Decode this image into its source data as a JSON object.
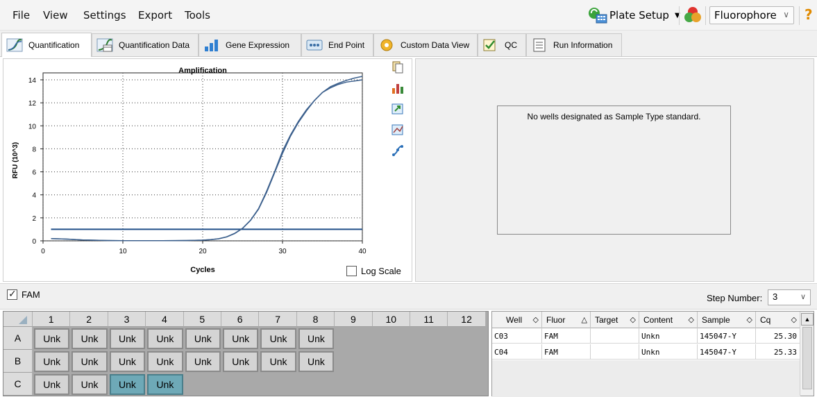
{
  "menu": {
    "items": [
      "File",
      "View",
      "Settings",
      "Export",
      "Tools"
    ]
  },
  "toolbar": {
    "plate_setup_label": "Plate Setup",
    "fluorophore_select": "Fluorophore",
    "help_symbol": "?"
  },
  "tabs": [
    {
      "label": "Quantification",
      "icon": "amplification-icon",
      "active": true
    },
    {
      "label": "Quantification Data",
      "icon": "quant-data-icon"
    },
    {
      "label": "Gene Expression",
      "icon": "bar-chart-icon"
    },
    {
      "label": "End Point",
      "icon": "end-point-icon"
    },
    {
      "label": "Custom Data View",
      "icon": "puzzle-icon"
    },
    {
      "label": "QC",
      "icon": "qc-check-icon"
    },
    {
      "label": "Run Information",
      "icon": "document-icon"
    }
  ],
  "chart_data": {
    "type": "line",
    "title": "Amplification",
    "xlabel": "Cycles",
    "ylabel": "RFU (10^3)",
    "xlim": [
      0,
      40
    ],
    "ylim": [
      0,
      14
    ],
    "xticks": [
      0,
      10,
      20,
      30,
      40
    ],
    "yticks": [
      0,
      2,
      4,
      6,
      8,
      10,
      12,
      14
    ],
    "grid": true,
    "threshold": 1.0,
    "series": [
      {
        "x": [
          1,
          3,
          5,
          8,
          10,
          12,
          15,
          18,
          20,
          21,
          22,
          23,
          24,
          25,
          26,
          27,
          28,
          29,
          30,
          31,
          32,
          33,
          34,
          35,
          36,
          37,
          38,
          39,
          40
        ],
        "values": [
          0.2,
          0.15,
          0.08,
          0.03,
          0.02,
          0.02,
          0.02,
          0.03,
          0.06,
          0.1,
          0.18,
          0.35,
          0.65,
          1.1,
          1.8,
          2.8,
          4.3,
          6.0,
          7.8,
          9.2,
          10.4,
          11.4,
          12.2,
          12.9,
          13.3,
          13.6,
          13.8,
          13.9,
          14.0
        ]
      },
      {
        "x": [
          1,
          3,
          5,
          8,
          10,
          12,
          15,
          18,
          20,
          21,
          22,
          23,
          24,
          25,
          26,
          27,
          28,
          29,
          30,
          31,
          32,
          33,
          34,
          35,
          36,
          37,
          38,
          39,
          40
        ],
        "values": [
          0.2,
          0.15,
          0.08,
          0.03,
          0.02,
          0.02,
          0.02,
          0.03,
          0.06,
          0.1,
          0.18,
          0.34,
          0.63,
          1.08,
          1.78,
          2.75,
          4.2,
          5.9,
          7.6,
          9.1,
          10.3,
          11.3,
          12.2,
          12.9,
          13.4,
          13.7,
          13.95,
          14.15,
          14.3
        ]
      }
    ],
    "log_scale_label": "Log Scale"
  },
  "standard_panel": {
    "message": "No wells designated as Sample Type standard."
  },
  "filter_bar": {
    "fam_label": "FAM",
    "step_label": "Step Number:",
    "step_value": "3"
  },
  "plate": {
    "columns": [
      "1",
      "2",
      "3",
      "4",
      "5",
      "6",
      "7",
      "8",
      "9",
      "10",
      "11",
      "12"
    ],
    "rows": [
      {
        "label": "A",
        "wells": [
          "Unk",
          "Unk",
          "Unk",
          "Unk",
          "Unk",
          "Unk",
          "Unk",
          "Unk",
          "",
          "",
          "",
          ""
        ],
        "selected": []
      },
      {
        "label": "B",
        "wells": [
          "Unk",
          "Unk",
          "Unk",
          "Unk",
          "Unk",
          "Unk",
          "Unk",
          "Unk",
          "",
          "",
          "",
          ""
        ],
        "selected": []
      },
      {
        "label": "C",
        "wells": [
          "Unk",
          "Unk",
          "Unk",
          "Unk",
          "",
          "",
          "",
          "",
          "",
          "",
          "",
          ""
        ],
        "selected": [
          2,
          3
        ]
      }
    ]
  },
  "results_table": {
    "headers": [
      {
        "label": "Well",
        "sort": "◇"
      },
      {
        "label": "Fluor",
        "sort": "△"
      },
      {
        "label": "Target",
        "sort": "◇"
      },
      {
        "label": "Content",
        "sort": "◇"
      },
      {
        "label": "Sample",
        "sort": "◇"
      },
      {
        "label": "Cq",
        "sort": "◇"
      }
    ],
    "rows": [
      [
        "C03",
        "FAM",
        "",
        "Unkn",
        "145047-Y",
        "25.30"
      ],
      [
        "C04",
        "FAM",
        "",
        "Unkn",
        "145047-Y",
        "25.33"
      ]
    ]
  },
  "colors": {
    "curve": "#3b5f8c",
    "threshold": "#1f4e88",
    "selected_well": "#6ea9b7",
    "well": "#d4d4d4"
  }
}
